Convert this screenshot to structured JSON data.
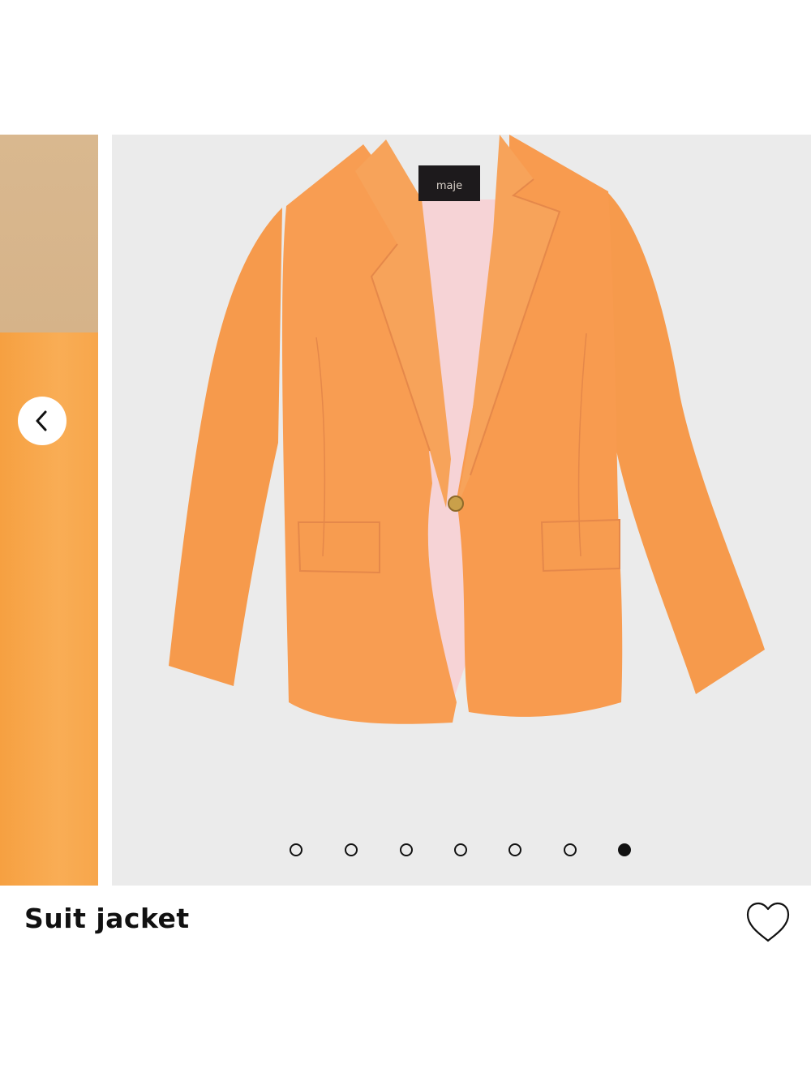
{
  "product": {
    "title": "Suit jacket",
    "brand_label": "maje"
  },
  "gallery": {
    "image_count": 7,
    "active_index": 6,
    "prev_icon": "chevron-left-icon",
    "favorite_icon": "heart-outline-icon"
  },
  "colors": {
    "jacket": "#f89d52",
    "lining": "#f6d3d6",
    "photo_bg": "#ebebeb",
    "dot": "#111111"
  }
}
